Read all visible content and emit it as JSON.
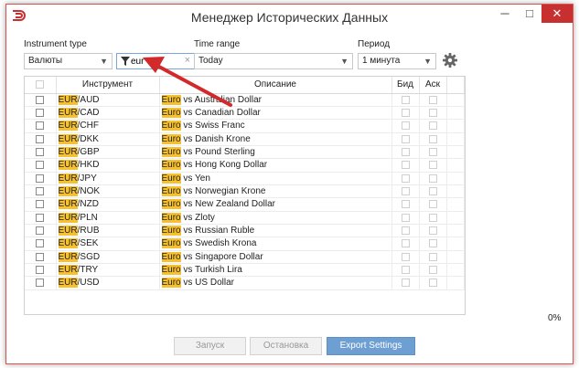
{
  "window": {
    "title": "Менеджер Исторических Данных",
    "minimize": "─",
    "maximize": "□",
    "close": "✕"
  },
  "controls": {
    "instrument_type_label": "Instrument type",
    "instrument_type_value": "Валюты",
    "filter_value": "eur",
    "filter_clear": "×",
    "time_range_label": "Time range",
    "time_range_value": "Today",
    "period_label": "Период",
    "period_value": "1 минута"
  },
  "table": {
    "headers": {
      "instrument": "Инструмент",
      "description": "Описание",
      "bid": "Бид",
      "ask": "Аск"
    },
    "rows": [
      {
        "hl": "EUR",
        "rest": "/AUD",
        "dhl": "Euro",
        "drest": " vs Australian Dollar"
      },
      {
        "hl": "EUR",
        "rest": "/CAD",
        "dhl": "Euro",
        "drest": " vs Canadian Dollar"
      },
      {
        "hl": "EUR",
        "rest": "/CHF",
        "dhl": "Euro",
        "drest": " vs Swiss Franc"
      },
      {
        "hl": "EUR",
        "rest": "/DKK",
        "dhl": "Euro",
        "drest": " vs Danish Krone"
      },
      {
        "hl": "EUR",
        "rest": "/GBP",
        "dhl": "Euro",
        "drest": " vs Pound Sterling"
      },
      {
        "hl": "EUR",
        "rest": "/HKD",
        "dhl": "Euro",
        "drest": " vs Hong Kong Dollar"
      },
      {
        "hl": "EUR",
        "rest": "/JPY",
        "dhl": "Euro",
        "drest": " vs Yen"
      },
      {
        "hl": "EUR",
        "rest": "/NOK",
        "dhl": "Euro",
        "drest": " vs Norwegian Krone"
      },
      {
        "hl": "EUR",
        "rest": "/NZD",
        "dhl": "Euro",
        "drest": " vs New Zealand Dollar"
      },
      {
        "hl": "EUR",
        "rest": "/PLN",
        "dhl": "Euro",
        "drest": " vs Zloty"
      },
      {
        "hl": "EUR",
        "rest": "/RUB",
        "dhl": "Euro",
        "drest": " vs Russian Ruble"
      },
      {
        "hl": "EUR",
        "rest": "/SEK",
        "dhl": "Euro",
        "drest": " vs Swedish Krona"
      },
      {
        "hl": "EUR",
        "rest": "/SGD",
        "dhl": "Euro",
        "drest": " vs Singapore Dollar"
      },
      {
        "hl": "EUR",
        "rest": "/TRY",
        "dhl": "Euro",
        "drest": " vs Turkish Lira"
      },
      {
        "hl": "EUR",
        "rest": "/USD",
        "dhl": "Euro",
        "drest": " vs US Dollar"
      }
    ]
  },
  "progress": {
    "label": "0%",
    "value": 0
  },
  "buttons": {
    "run": "Запуск",
    "stop": "Остановка",
    "export": "Export Settings"
  },
  "colors": {
    "highlight": "#f6c02e",
    "close": "#c7302e",
    "export": "#6e9fd3",
    "arrow": "#d22a2a"
  },
  "icons": {
    "app": "app-logo-icon",
    "filter": "filter-funnel-icon",
    "settings": "gear-icon",
    "annotation": "red-arrow-icon"
  }
}
